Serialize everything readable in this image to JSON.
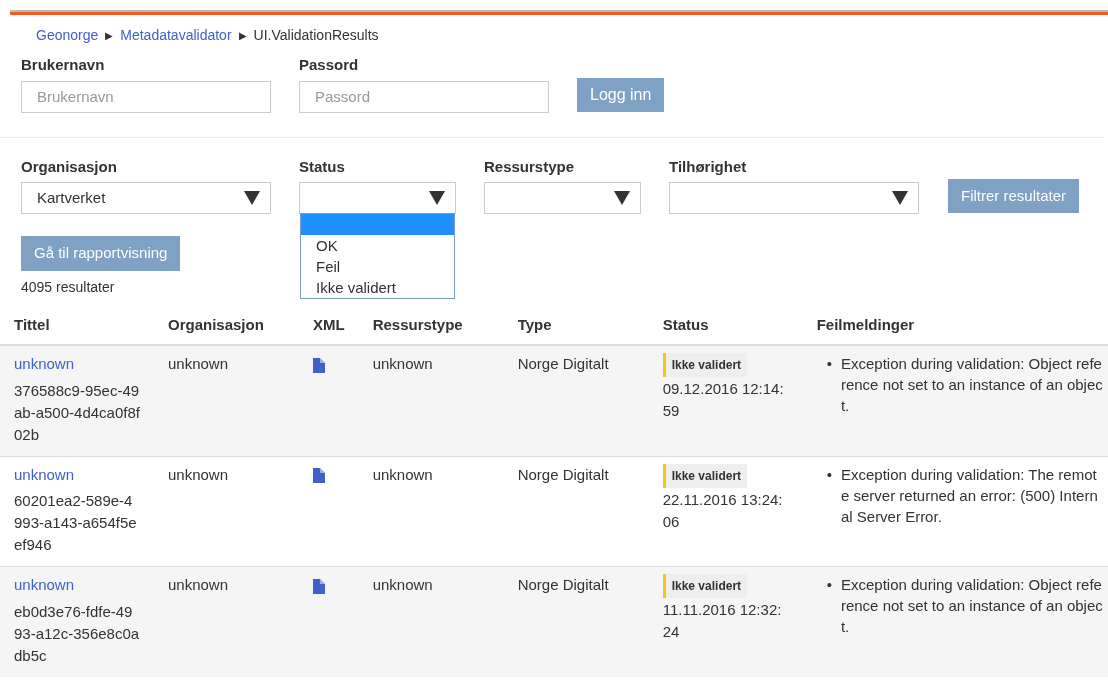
{
  "breadcrumb": [
    {
      "label": "Geonorge",
      "link": true
    },
    {
      "label": "Metadatavalidator",
      "link": true
    },
    {
      "label": "UI.ValidationResults",
      "link": false
    }
  ],
  "breadcrumb_separator": "▶",
  "login": {
    "fields": [
      {
        "label": "Brukernavn",
        "placeholder": "Brukernavn"
      },
      {
        "label": "Passord",
        "placeholder": "Passord"
      }
    ],
    "button": "Logg inn"
  },
  "filters": [
    {
      "label": "Organisasjon",
      "value": "Kartverket"
    },
    {
      "label": "Status",
      "options": [
        {
          "selected": true
        },
        {
          "label": "OK",
          "selected": false
        },
        {
          "label": "Feil",
          "selected": false
        },
        {
          "label": "Ikke validert",
          "selected": false
        }
      ]
    },
    {
      "label": "Ressurstype"
    },
    {
      "label": "Tilhørighet"
    }
  ],
  "filter_button": "Filtrer resultater",
  "report_button": "Gå til rapportvisning",
  "result_count": "4095 resultater",
  "table": {
    "columns": [
      "Tittel",
      "Organisasjon",
      "XML",
      "Ressurstype",
      "Type",
      "Status",
      "Feilmeldinger"
    ],
    "rows": [
      {
        "title": "unknown",
        "uuid": "376588c9-95ec-49ab-a500-4d4ca0f8f02b",
        "organisation": "unknown",
        "resource_type": "unknown",
        "type": "Norge Digitalt",
        "status": "Ikke validert",
        "date": "09.12.2016 12:14:59",
        "errors": [
          {
            "bullet": "•",
            "lines": [
              "Exception during validation: Object refe",
              "rence not set to an instance of an objec",
              "t."
            ]
          }
        ]
      },
      {
        "title": "unknown",
        "uuid": "60201ea2-589e-4993-a143-a654f5eef946",
        "organisation": "unknown",
        "resource_type": "unknown",
        "type": "Norge Digitalt",
        "status": "Ikke validert",
        "date": "22.11.2016 13:24:06",
        "errors": [
          {
            "bullet": "•",
            "lines": [
              "Exception during validation: The remot",
              "e server returned an error: (500) Intern",
              "al Server Error."
            ]
          }
        ]
      },
      {
        "title": "unknown",
        "uuid": "eb0d3e76-fdfe-4993-a12c-356e8c0adb5c",
        "organisation": "unknown",
        "resource_type": "unknown",
        "type": "Norge Digitalt",
        "status": "Ikke validert",
        "date": "11.11.2016 12:32:24",
        "errors": [
          {
            "bullet": "•",
            "lines": [
              "Exception during validation: Object refe",
              "rence not set to an instance of an objec",
              "t."
            ]
          }
        ]
      }
    ]
  }
}
